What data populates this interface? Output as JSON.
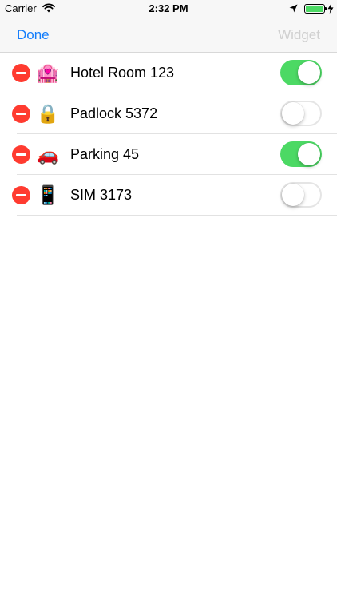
{
  "status_bar": {
    "carrier": "Carrier",
    "time": "2:32 PM",
    "wifi_icon": "wifi-icon",
    "location_icon": "location-arrow-icon",
    "battery_icon": "battery-icon",
    "battery_level": 1.0,
    "charging_icon": "charging-bolt-icon",
    "battery_color": "#4cd964"
  },
  "nav": {
    "done_label": "Done",
    "widget_label": "Widget",
    "done_color": "#157efb",
    "widget_color": "#d0d0d0"
  },
  "items": [
    {
      "emoji": "🏩",
      "icon": "love-hotel-icon",
      "label": "Hotel Room 123",
      "enabled": true
    },
    {
      "emoji": "🔒",
      "icon": "padlock-icon",
      "label": "Padlock 5372",
      "enabled": false
    },
    {
      "emoji": "🚗",
      "icon": "car-icon",
      "label": "Parking 45",
      "enabled": true
    },
    {
      "emoji": "📱",
      "icon": "mobile-phone-icon",
      "label": "SIM 3173",
      "enabled": false
    }
  ],
  "colors": {
    "delete": "#ff3b30",
    "toggle_on": "#4cd964"
  }
}
